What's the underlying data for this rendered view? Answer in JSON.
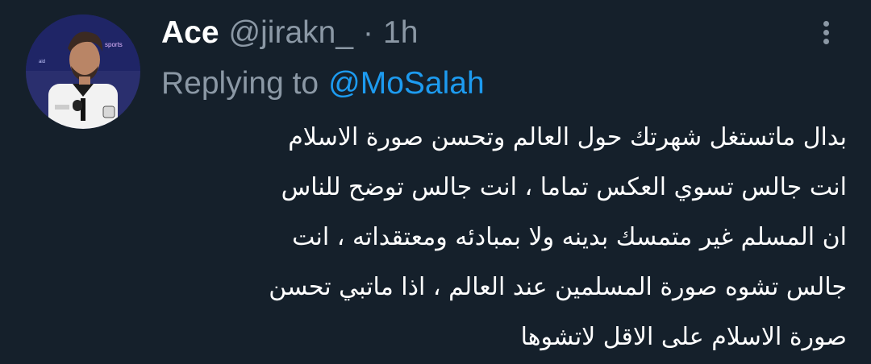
{
  "tweet": {
    "display_name": "Ace",
    "handle": "@jirakn_",
    "separator": "·",
    "time": "1h",
    "replying_prefix": "Replying to",
    "replying_to": "@MoSalah",
    "text_lines": [
      "بدال ماتستغل شهرتك حول العالم وتحسن صورة الاسلام",
      "انت جالس تسوي العكس تماما ، انت جالس توضح للناس",
      "ان المسلم غير متمسك بدينه ولا بمبادئه ومعتقداته ، انت",
      "جالس تشوه صورة المسلمين عند العالم ، اذا ماتبي تحسن",
      "صورة الاسلام على الاقل لاتشوها"
    ]
  },
  "icons": {
    "more": "more-vertical-icon",
    "avatar": "user-avatar"
  },
  "colors": {
    "background": "#15202b",
    "primary_text": "#ffffff",
    "secondary_text": "#8b98a5",
    "accent": "#1d9bf0"
  }
}
